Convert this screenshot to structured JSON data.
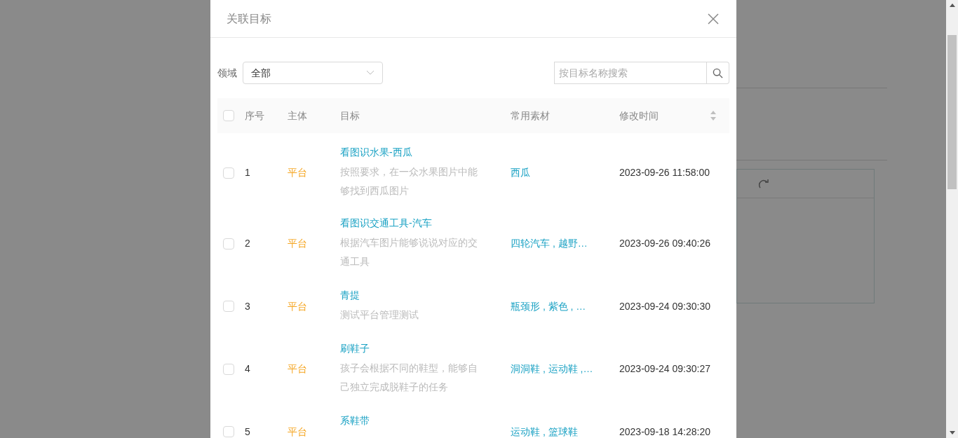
{
  "dialog": {
    "title": "关联目标"
  },
  "filter": {
    "label": "领域",
    "value": "全部"
  },
  "search": {
    "placeholder": "按目标名称搜索"
  },
  "table": {
    "all_checked": false,
    "columns": [
      "序号",
      "主体",
      "目标",
      "常用素材",
      "修改时间"
    ],
    "rows": [
      {
        "checked": false,
        "index": "1",
        "owner": "平台",
        "name": "看图识水果-西瓜",
        "description": "按照要求，在一众水果图片中能够找到西瓜图片",
        "materials": "西瓜",
        "time": "2023-09-26 11:58:00"
      },
      {
        "checked": false,
        "index": "2",
        "owner": "平台",
        "name": "看图识交通工具-汽车",
        "description": "根据汽车图片能够说说对应的交通工具",
        "materials": "四轮汽车 , 越野…",
        "time": "2023-09-26 09:40:26"
      },
      {
        "checked": false,
        "index": "3",
        "owner": "平台",
        "name": "青提",
        "description": "测试平台管理测试",
        "materials": "瓶颈形 , 紫色 , …",
        "time": "2023-09-24 09:30:30"
      },
      {
        "checked": false,
        "index": "4",
        "owner": "平台",
        "name": "刷鞋子",
        "description": "孩子会根据不同的鞋型，能够自己独立完成脱鞋子的任务",
        "materials": "洞洞鞋 , 运动鞋 ,…",
        "time": "2023-09-24 09:30:27"
      },
      {
        "checked": false,
        "index": "5",
        "owner": "平台",
        "name": "系鞋带",
        "materials": "运动鞋 , 篮球鞋",
        "time": "2023-09-18 14:28:20"
      }
    ]
  }
}
